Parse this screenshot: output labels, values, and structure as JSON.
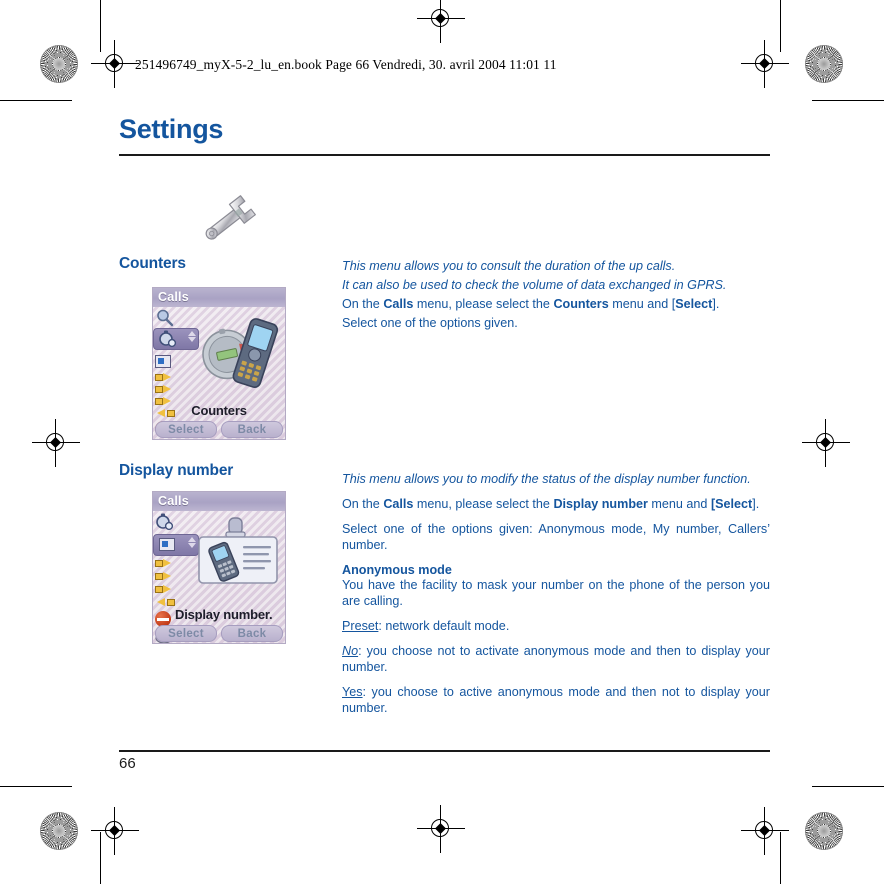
{
  "document": {
    "file_header": "251496749_myX-5-2_lu_en.book  Page 66  Vendredi, 30. avril 2004  11:01 11",
    "title": "Settings",
    "page_number": "66",
    "accent_color": "#14559e",
    "chapter_icon": "wrench-icon"
  },
  "sections": [
    {
      "heading": "Counters",
      "phone": {
        "titlebar": "Calls",
        "caption": "Counters",
        "softkeys": [
          "Select",
          "Back"
        ],
        "selected_icon": "stopwatch-icon",
        "rail_icons": [
          "magnifier-icon",
          "stopwatch-icon",
          "display-icon",
          "arrow-right-icon",
          "arrow-right-icon",
          "arrow-right-icon",
          "arrow-left-icon",
          "no-entry-icon"
        ]
      },
      "paragraphs": [
        {
          "style": "italic",
          "runs": [
            {
              "text": "This menu allows you to consult the duration of the up calls."
            }
          ]
        },
        {
          "style": "italic",
          "runs": [
            {
              "text": "It can also be used to check the volume of data exchanged in GPRS."
            }
          ]
        },
        {
          "style": "normal",
          "runs": [
            {
              "text": "On the "
            },
            {
              "text": "Calls",
              "bold": true
            },
            {
              "text": " menu, please select the "
            },
            {
              "text": "Counters",
              "bold": true
            },
            {
              "text": " menu and ["
            },
            {
              "text": "Select",
              "bold": true
            },
            {
              "text": "]."
            }
          ]
        },
        {
          "style": "normal",
          "runs": [
            {
              "text": "Select one of the options given."
            }
          ]
        }
      ]
    },
    {
      "heading": "Display number",
      "phone": {
        "titlebar": "Calls",
        "caption": "Display number.",
        "softkeys": [
          "Select",
          "Back"
        ],
        "selected_icon": "display-icon",
        "rail_icons": [
          "stopwatch-icon",
          "display-icon",
          "arrow-right-icon",
          "arrow-right-icon",
          "arrow-right-icon",
          "arrow-left-icon",
          "no-entry-icon",
          "mask-icon"
        ]
      },
      "paragraphs": [
        {
          "style": "italic",
          "runs": [
            {
              "text": "This menu allows you to modify the status of the display number function."
            }
          ]
        },
        {
          "style": "normal",
          "runs": [
            {
              "text": "On the "
            },
            {
              "text": "Calls",
              "bold": true
            },
            {
              "text": " menu, please select the "
            },
            {
              "text": "Display number",
              "bold": true
            },
            {
              "text": " menu and "
            },
            {
              "text": "[Select",
              "bold": true
            },
            {
              "text": "]."
            }
          ]
        },
        {
          "style": "normal",
          "runs": [
            {
              "text": "Select one of the options given: Anonymous mode, My number, Callers’ number."
            }
          ]
        },
        {
          "style": "subheading",
          "runs": [
            {
              "text": "Anonymous mode"
            }
          ]
        },
        {
          "style": "normal",
          "runs": [
            {
              "text": "You have the facility to mask your number on the phone of the person you are calling."
            }
          ]
        },
        {
          "style": "normal",
          "runs": [
            {
              "text": "Preset",
              "underline": true
            },
            {
              "text": ": network default mode."
            }
          ]
        },
        {
          "style": "normal",
          "runs": [
            {
              "text": "No",
              "underline": true,
              "italic": true
            },
            {
              "text": ": you choose not to activate anonymous mode and then to display your number."
            }
          ]
        },
        {
          "style": "normal",
          "runs": [
            {
              "text": "Yes",
              "underline": true
            },
            {
              "text": ": you choose to active anonymous mode and then not to display your number."
            }
          ]
        }
      ]
    }
  ]
}
